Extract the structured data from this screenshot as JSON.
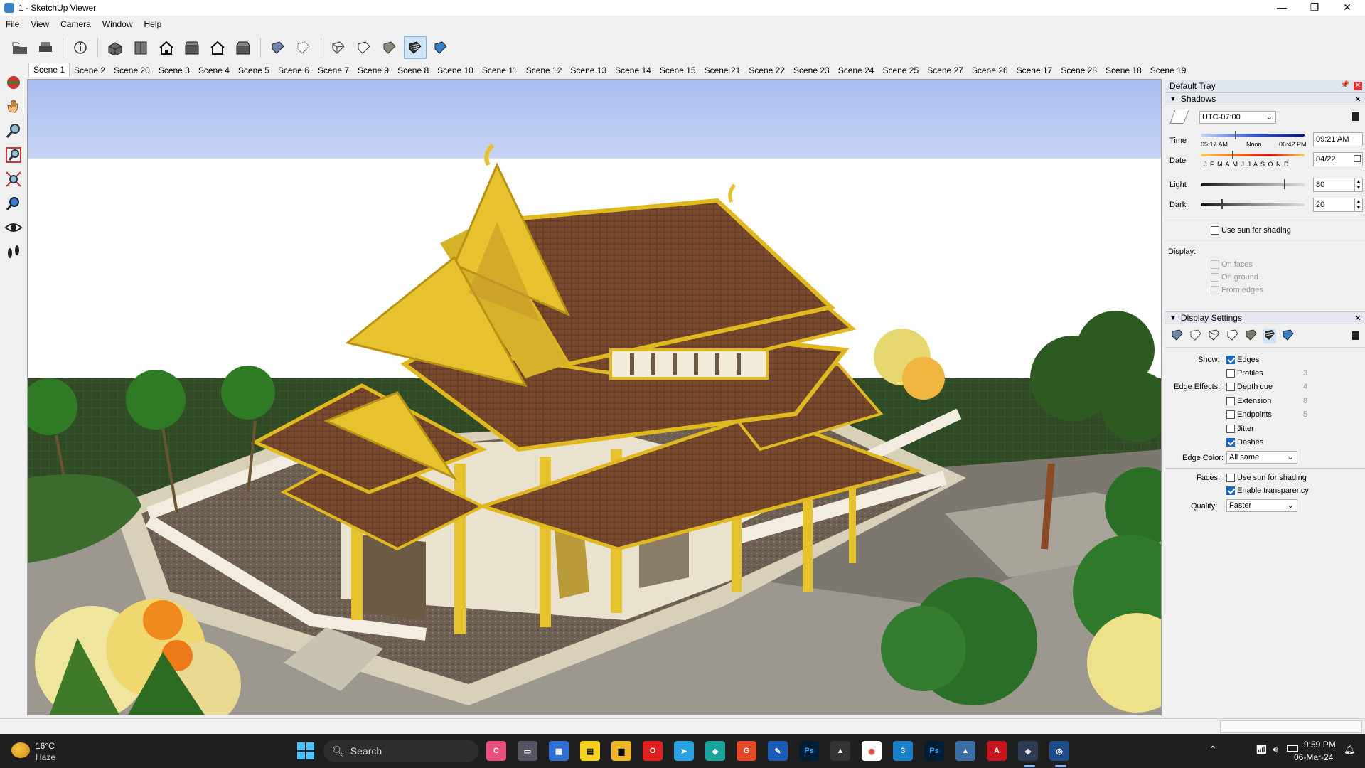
{
  "window": {
    "title": "1 - SketchUp Viewer",
    "minimize": "—",
    "maximize": "❐",
    "close": "✕"
  },
  "menu": [
    "File",
    "View",
    "Camera",
    "Window",
    "Help"
  ],
  "toolbar_icons": [
    "open-file",
    "print",
    "model-info",
    "iso-view",
    "top-view",
    "front-view",
    "right-view",
    "back-view",
    "left-view",
    "xray",
    "back-edges",
    "wireframe",
    "hidden-line",
    "shaded",
    "shaded-textures",
    "monochrome"
  ],
  "scenes": [
    "Scene 1",
    "Scene 2",
    "Scene 20",
    "Scene 3",
    "Scene 4",
    "Scene 5",
    "Scene 6",
    "Scene 7",
    "Scene 9",
    "Scene 8",
    "Scene 10",
    "Scene 11",
    "Scene 12",
    "Scene 13",
    "Scene 14",
    "Scene 15",
    "Scene 21",
    "Scene 22",
    "Scene 23",
    "Scene 24",
    "Scene 25",
    "Scene 27",
    "Scene 26",
    "Scene 17",
    "Scene 28",
    "Scene 18",
    "Scene 19"
  ],
  "left_tools": [
    "orbit",
    "pan",
    "zoom",
    "zoom-window",
    "zoom-extents",
    "look-around",
    "walk",
    "position-camera"
  ],
  "tray": {
    "title": "Default Tray",
    "shadows": {
      "header": "Shadows",
      "timezone": "UTC-07:00",
      "time_label": "Time",
      "time_start": "05:17 AM",
      "time_noon": "Noon",
      "time_end": "06:42 PM",
      "time_value": "09:21 AM",
      "time_fraction": 0.33,
      "date_label": "Date",
      "months": "J F M A M J J A S O N D",
      "date_value": "04/22",
      "date_fraction": 0.3,
      "light_label": "Light",
      "light_value": "80",
      "light_fraction": 0.8,
      "dark_label": "Dark",
      "dark_value": "20",
      "dark_fraction": 0.2,
      "use_sun": "Use sun for shading",
      "display_label": "Display:",
      "on_faces": "On faces",
      "on_ground": "On ground",
      "from_edges": "From edges"
    },
    "display_settings": {
      "header": "Display Settings",
      "show_label": "Show:",
      "edges": "Edges",
      "effects_label": "Edge Effects:",
      "profiles": "Profiles",
      "profiles_val": "3",
      "depth_cue": "Depth cue",
      "depth_cue_val": "4",
      "extension": "Extension",
      "extension_val": "8",
      "endpoints": "Endpoints",
      "endpoints_val": "5",
      "jitter": "Jitter",
      "dashes": "Dashes",
      "edge_color_label": "Edge Color:",
      "edge_color": "All same",
      "faces_label": "Faces:",
      "use_sun": "Use sun for shading",
      "transparency": "Enable transparency",
      "quality_label": "Quality:",
      "quality": "Faster"
    }
  },
  "taskbar": {
    "weather_temp": "16°C",
    "weather_desc": "Haze",
    "search": "Search",
    "time": "9:59 PM",
    "date": "06-Mar-24"
  }
}
